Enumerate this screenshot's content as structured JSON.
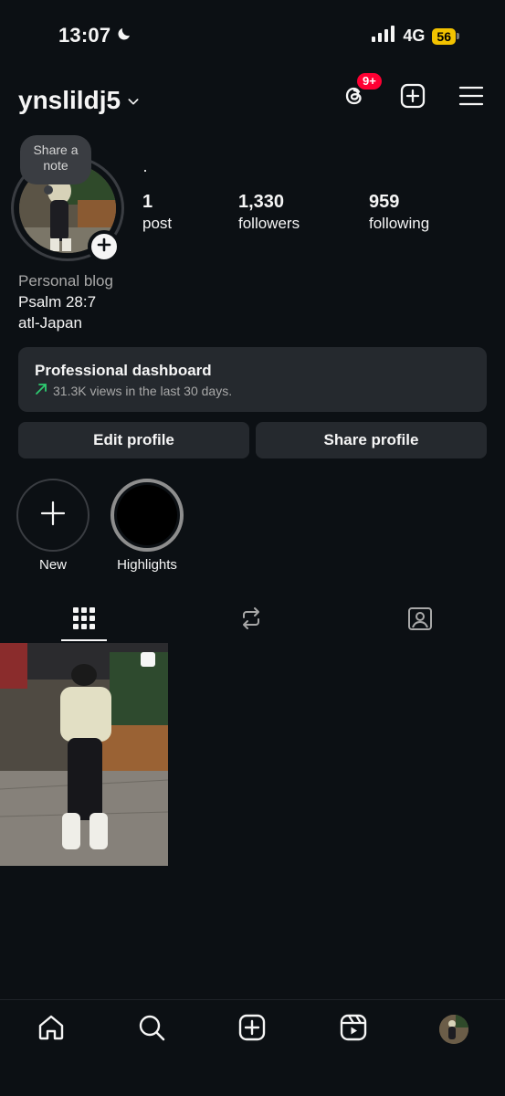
{
  "status_bar": {
    "time": "13:07",
    "network": "4G",
    "battery": "56"
  },
  "header": {
    "username": "ynslildj5",
    "threads_badge": "9+"
  },
  "profile": {
    "note_label": "Share a note",
    "display_name": "·",
    "stats": [
      {
        "value": "1",
        "label": "post"
      },
      {
        "value": "1,330",
        "label": "followers"
      },
      {
        "value": "959",
        "label": "following"
      }
    ],
    "bio": {
      "category": "Personal blog",
      "lines": [
        "Psalm 28:7",
        "atl-Japan"
      ]
    }
  },
  "dashboard": {
    "title": "Professional dashboard",
    "subtitle": "31.3K views in the last 30 days."
  },
  "actions": {
    "edit": "Edit profile",
    "share": "Share profile"
  },
  "highlights": [
    {
      "label": "New"
    },
    {
      "label": "Highlights"
    }
  ],
  "colors": {
    "background": "#0c1014",
    "surface": "#25292e",
    "badge": "#ff0033",
    "trend": "#2ecc71"
  }
}
